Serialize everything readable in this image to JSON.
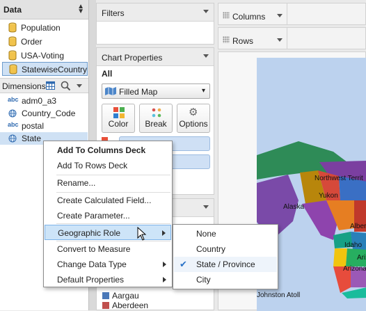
{
  "data_panel": {
    "title": "Data",
    "sources": [
      {
        "label": "Population"
      },
      {
        "label": "Order"
      },
      {
        "label": "USA-Voting"
      },
      {
        "label": "StatewiseCountry",
        "selected": true
      }
    ]
  },
  "dimensions": {
    "title": "Dimensions",
    "items": [
      {
        "type_badge": "abc",
        "label": "adm0_a3"
      },
      {
        "type_badge": "globe",
        "label": "Country_Code"
      },
      {
        "type_badge": "abc",
        "label": "postal"
      },
      {
        "type_badge": "globe",
        "label": "State",
        "selected": true
      }
    ]
  },
  "filters": {
    "title": "Filters"
  },
  "chart_properties": {
    "title": "Chart Properties",
    "scope": "All",
    "chart_type": "Filled Map",
    "buttons": {
      "color": "Color",
      "break": "Break",
      "options": "Options"
    }
  },
  "legend": {
    "items": [
      {
        "label": "Aargau",
        "color": "#4a78b8"
      },
      {
        "label": "Aberdeen",
        "color": "#c0504d"
      }
    ]
  },
  "columns_deck": {
    "label": "Columns"
  },
  "rows_deck": {
    "label": "Rows"
  },
  "context_menu": {
    "items": [
      {
        "label": "Add To Columns Deck",
        "bold": true
      },
      {
        "label": "Add To Rows Deck"
      },
      {
        "label": "Rename..."
      },
      {
        "label": "Create Calculated Field..."
      },
      {
        "label": "Create Parameter..."
      },
      {
        "label": "Geographic Role",
        "has_submenu": true,
        "highlighted": true
      },
      {
        "label": "Convert to Measure"
      },
      {
        "label": "Change Data Type",
        "has_submenu": true
      },
      {
        "label": "Default Properties",
        "has_submenu": true
      }
    ]
  },
  "geo_submenu": {
    "items": [
      {
        "label": "None"
      },
      {
        "label": "Country"
      },
      {
        "label": "State / Province",
        "checked": true
      },
      {
        "label": "City"
      }
    ]
  },
  "map": {
    "labels": [
      "Northwest Territ",
      "Yukon",
      "Alaska",
      "Albert",
      "Idaho",
      "Ariz",
      "Arizona",
      "Johnston Atoll"
    ]
  },
  "colors": {
    "accent": "#2a72c7",
    "selection_bg": "#cfe1f4",
    "menu_highlight": "#cde4f8"
  }
}
